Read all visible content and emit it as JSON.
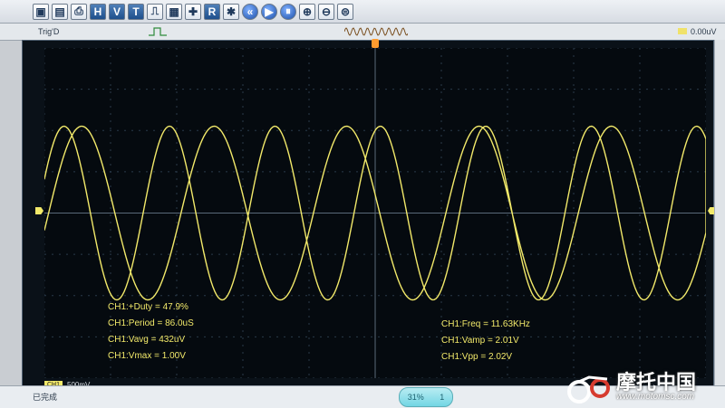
{
  "toolbar": {
    "buttons": [
      "H",
      "V",
      "T",
      "R"
    ],
    "icons": [
      "monitor-icon",
      "save-icon",
      "print-icon",
      "h-button",
      "v-button",
      "t-button",
      "pulse-icon",
      "grid-icon",
      "cross-icon",
      "r-button",
      "settings-icon",
      "rewind-icon",
      "play-icon",
      "pause-icon",
      "zoom-in-icon",
      "zoom-out-icon",
      "script-icon"
    ]
  },
  "status": {
    "trigger_label": "Trig'D",
    "trigger_value": "0.00uV"
  },
  "channel": {
    "badge": "CH1",
    "scale": "500mV"
  },
  "measurements": {
    "left": [
      "CH1:+Duty = 47.9%",
      "CH1:Period = 86.0uS",
      "CH1:Vavg = 432uV",
      "CH1:Vmax = 1.00V"
    ],
    "right": [
      "CH1:Freq = 11.63KHz",
      "CH1:Vamp = 2.01V",
      "CH1:Vpp = 2.02V"
    ]
  },
  "bottom": {
    "left_status": "已完成",
    "pill_left": "31%",
    "pill_right": "1"
  },
  "watermark": {
    "title": "摩托中国",
    "url": "www.motomsc.com"
  },
  "colors": {
    "trace": "#f2e96a",
    "grid": "#2a3a4a",
    "screen": "#050a0f",
    "accent": "#4f7fb8"
  }
}
